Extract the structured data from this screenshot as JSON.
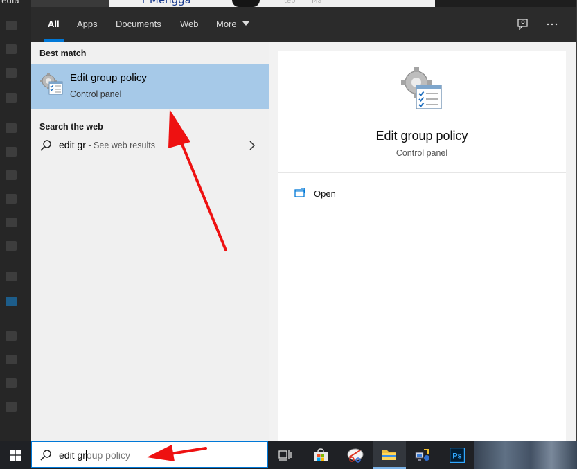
{
  "background": {
    "fragments": [
      "edia",
      "r Mengga",
      "tep",
      "Ma"
    ]
  },
  "tabs": [
    {
      "label": "All",
      "active": true
    },
    {
      "label": "Apps"
    },
    {
      "label": "Documents"
    },
    {
      "label": "Web"
    },
    {
      "label": "More"
    }
  ],
  "topbar_icons": [
    "feedback-icon",
    "more-options-icon"
  ],
  "results": {
    "best_match_label": "Best match",
    "best_match": {
      "title": "Edit group policy",
      "subtitle": "Control panel",
      "icon": "group-policy-icon"
    },
    "web_label": "Search the web",
    "web_item": {
      "query": "edit gr",
      "hint": " - See web results"
    }
  },
  "preview": {
    "title": "Edit group policy",
    "subtitle": "Control panel",
    "actions": [
      {
        "label": "Open",
        "icon": "open-window-icon"
      }
    ]
  },
  "taskbar": {
    "search_typed": "edit gr",
    "search_ghost": "oup policy",
    "items": [
      "task-view-icon",
      "store-icon",
      "snipping-tool-icon",
      "file-explorer-icon",
      "network-icon",
      "photoshop-icon"
    ],
    "photoshop_text": "Ps"
  },
  "colors": {
    "accent": "#0078d7",
    "selection": "#a6c9e8",
    "annotation_arrow": "#ee1111"
  }
}
